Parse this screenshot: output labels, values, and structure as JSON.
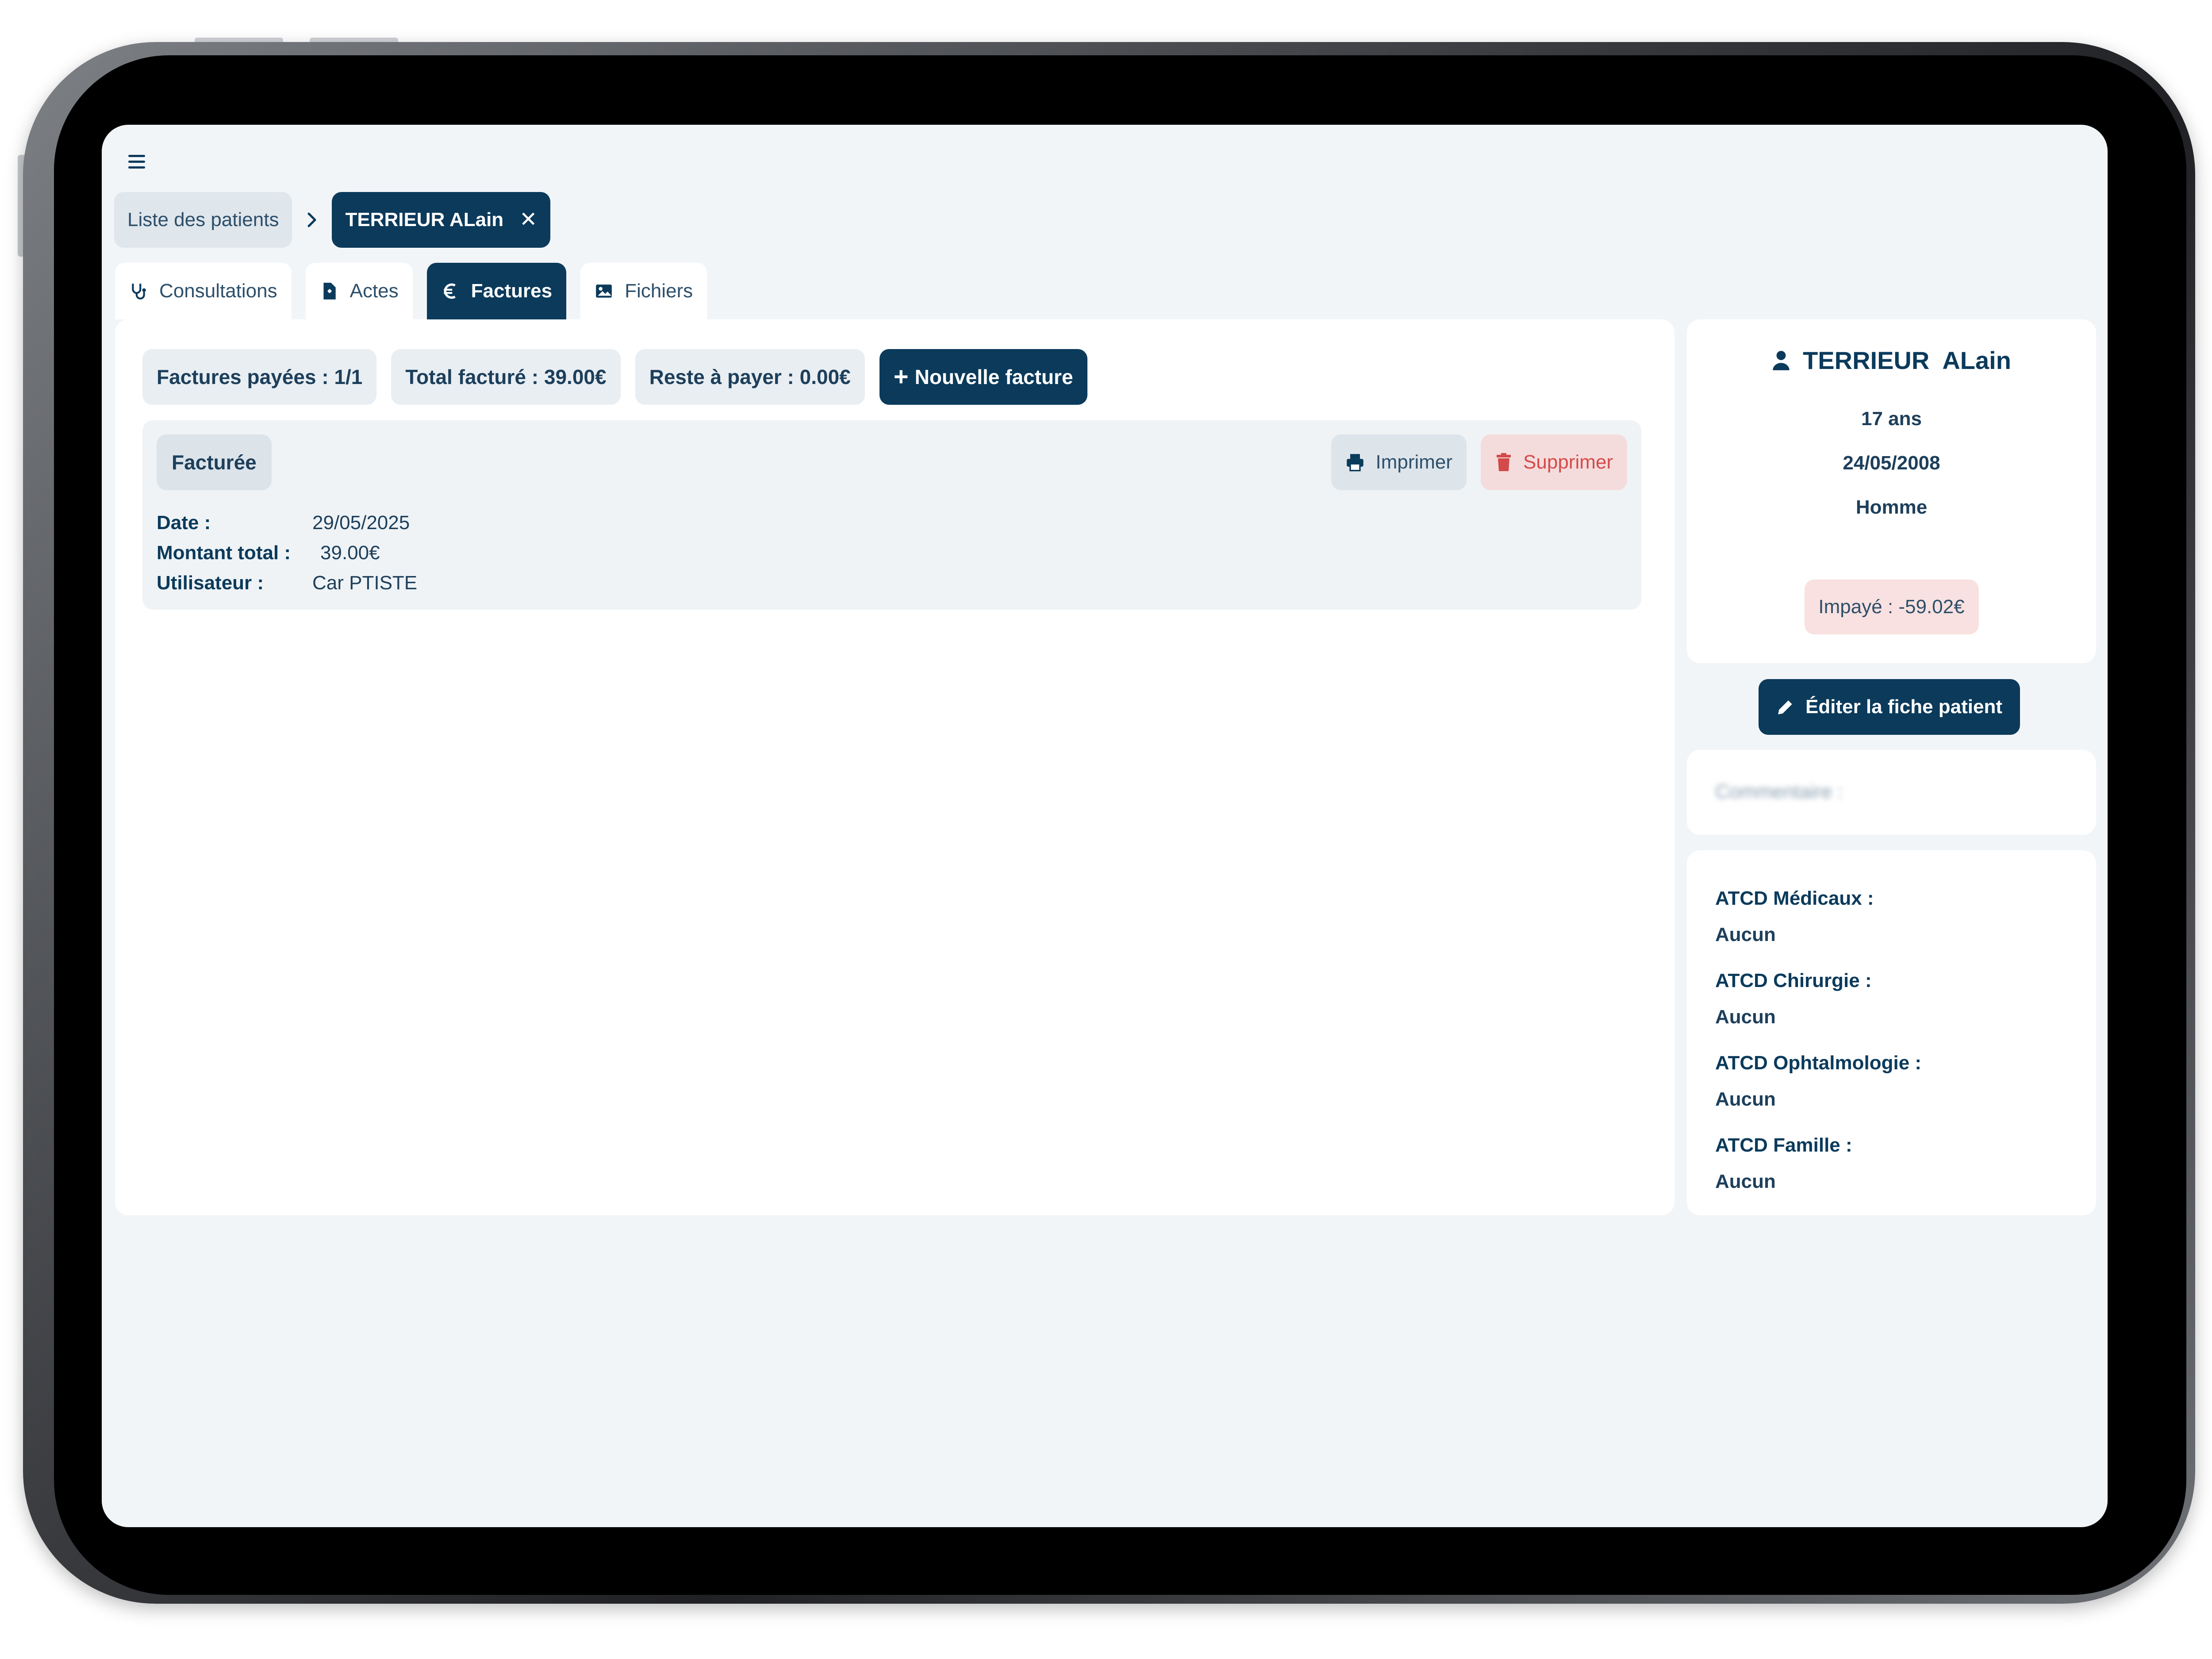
{
  "breadcrumb": {
    "parent": "Liste des patients",
    "current": "TERRIEUR ALain"
  },
  "tabs": [
    {
      "label": "Consultations",
      "icon": "stethoscope-icon"
    },
    {
      "label": "Actes",
      "icon": "file-medical-icon"
    },
    {
      "label": "Factures",
      "icon": "euro-icon",
      "active": true
    },
    {
      "label": "Fichiers",
      "icon": "image-icon"
    }
  ],
  "stats": {
    "paid": "Factures payées : 1/1",
    "total": "Total facturé : 39.00€",
    "remaining": "Reste à payer : 0.00€",
    "new_invoice": "Nouvelle facture"
  },
  "invoice": {
    "status": "Facturée",
    "print_label": "Imprimer",
    "delete_label": "Supprimer",
    "date_label": "Date :",
    "date": "29/05/2025",
    "amount_label": "Montant total :",
    "amount": "39.00€",
    "user_label": "Utilisateur :",
    "user": "Car PTISTE"
  },
  "patient": {
    "name": "TERRIEUR  ALain",
    "age": "17 ans",
    "birthdate": "24/05/2008",
    "gender": "Homme",
    "unpaid": "Impayé : -59.02€",
    "edit_label": "Éditer la fiche patient",
    "comment_label": "Commentaire :"
  },
  "atcd": [
    {
      "label": "ATCD Médicaux :",
      "value": "Aucun"
    },
    {
      "label": "ATCD Chirurgie :",
      "value": "Aucun"
    },
    {
      "label": "ATCD Ophtalmologie :",
      "value": "Aucun"
    },
    {
      "label": "ATCD Famille :",
      "value": "Aucun"
    }
  ],
  "colors": {
    "primary": "#0b3a5b",
    "background": "#f2f5f8",
    "danger": "#d44a4a",
    "unpaid_bg": "#f8e1e0"
  }
}
